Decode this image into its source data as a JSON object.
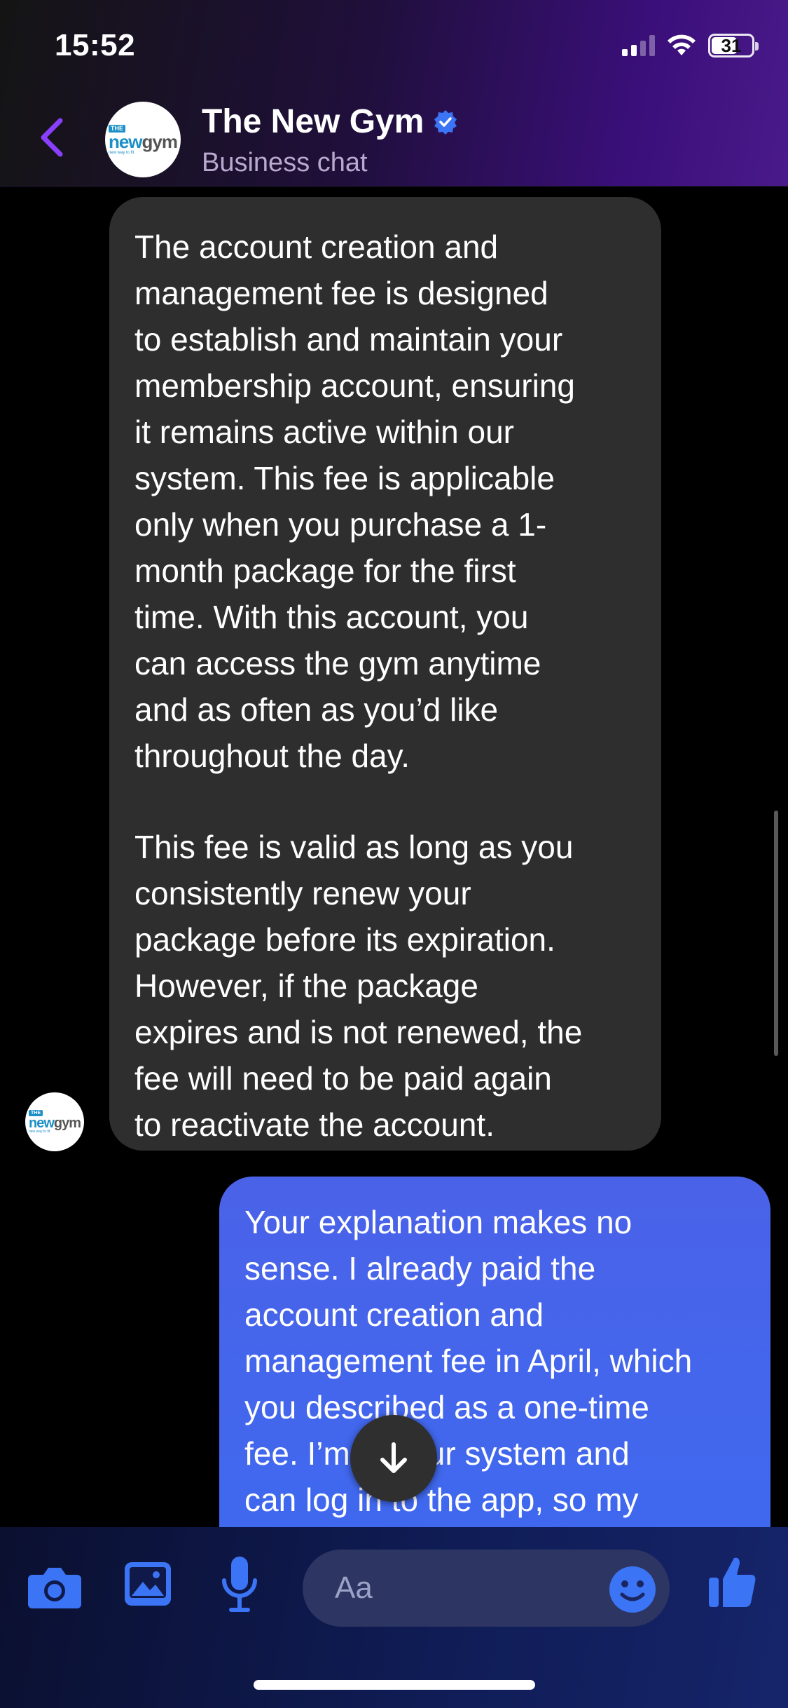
{
  "status_bar": {
    "time": "15:52",
    "battery": "31"
  },
  "header": {
    "title": "The New Gym",
    "subtitle": "Business chat",
    "logo": {
      "the": "THE",
      "new": "new",
      "gym": "gym",
      "tagline": "new way to fit"
    }
  },
  "messages": [
    {
      "direction": "incoming",
      "paragraphs": [
        "The account creation and\nmanagement fee is designed\nto establish and maintain your\nmembership account, ensuring\nit remains active within our\nsystem. This fee is applicable\nonly when you purchase a 1-\nmonth package for the first\ntime. With this account, you\ncan access the gym anytime\nand as often as you’d like\nthroughout the day.",
        "This fee is valid as long as you\nconsistently renew your\npackage before its expiration.\nHowever, if the package\nexpires and is not renewed, the\nfee will need to be paid again\nto reactivate the account."
      ]
    },
    {
      "direction": "outgoing",
      "text": "Your explanation makes no\nsense. I already paid the\naccount creation and\nmanagement fee in April, which\nyou described as a one-time\nfee. I’m in your system and\ncan log in to the app, so my"
    }
  ],
  "composer": {
    "placeholder": "Aa"
  },
  "icons": [
    "back-icon",
    "verified-icon",
    "camera-icon",
    "photo-icon",
    "microphone-icon",
    "emoji-icon",
    "thumbs-up-icon",
    "arrow-down-icon"
  ],
  "colors": {
    "accent": "#8a3ffc",
    "outgoing_bubble": "#3d6af0",
    "incoming_bubble": "#2e2e2e",
    "composer_icon": "#3b74f5"
  }
}
